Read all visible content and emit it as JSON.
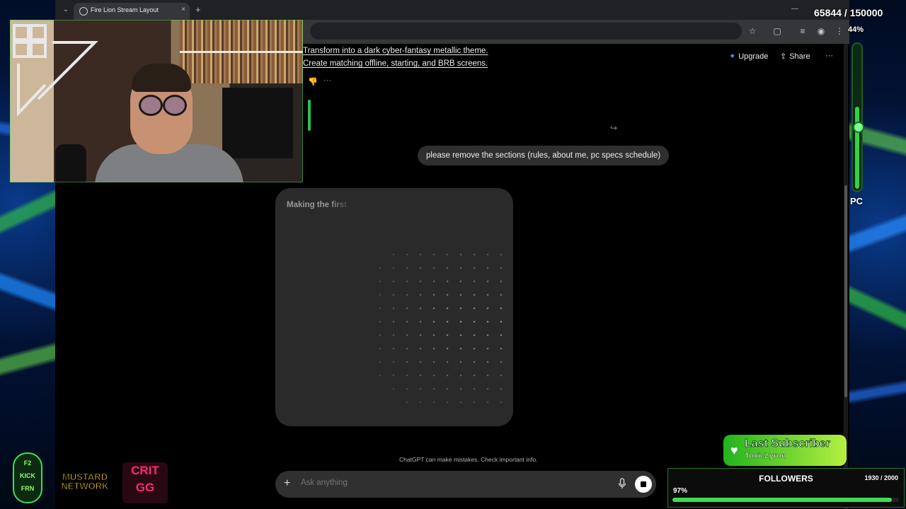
{
  "browser": {
    "tab_title": "Fire Lion Stream Layout",
    "tab_close": "×",
    "new_tab": "+",
    "tab_dropdown": "⌄",
    "window_minimize": "—",
    "toolbar_icons": [
      "bookmark-star-icon",
      "extensions-icon",
      "reading-list-icon",
      "profile-icon",
      "menu-icon"
    ]
  },
  "chat": {
    "prior_assistant_lines": [
      "Transform into a dark cyber-fantasy metallic theme.",
      "Create matching offline, starting, and BRB screens."
    ],
    "header": {
      "upgrade_label": "Upgrade",
      "share_label": "Share",
      "more_label": "···"
    },
    "action_icons": {
      "dislike": "👎",
      "more": "···"
    },
    "user_message": "please remove the sections (rules, about me, pc specs schedule)",
    "image_status": "Making the first",
    "disclaimer": "ChatGPT can make mistakes. Check important info.",
    "composer": {
      "plus": "+",
      "placeholder": "Ask anything",
      "mic": "🎙"
    }
  },
  "overlay": {
    "goal_counter": "65844 / 150000",
    "cpu_percent": "44%",
    "pc_label": "PC",
    "pc_gauge_fraction": 0.58,
    "last_subscriber": {
      "title": "Last Subscriber",
      "name": "ToxicZyron",
      "heart": "♥"
    },
    "followers": {
      "title": "FOLLOWERS",
      "count": "1930 / 2000",
      "percent_label": "97%",
      "progress": 0.97
    },
    "logos": {
      "kick_lines": [
        "F2",
        "KICK",
        "FRN"
      ],
      "mustard": "MUSTARD NETWORK",
      "crit_lines": [
        "CRIT",
        "GG"
      ]
    }
  },
  "colors": {
    "accent_green": "#34d04a",
    "upgrade_blue": "#6b8cff",
    "crit_pink": "#ff2a6a",
    "mustard_yellow": "#ffd21a"
  }
}
